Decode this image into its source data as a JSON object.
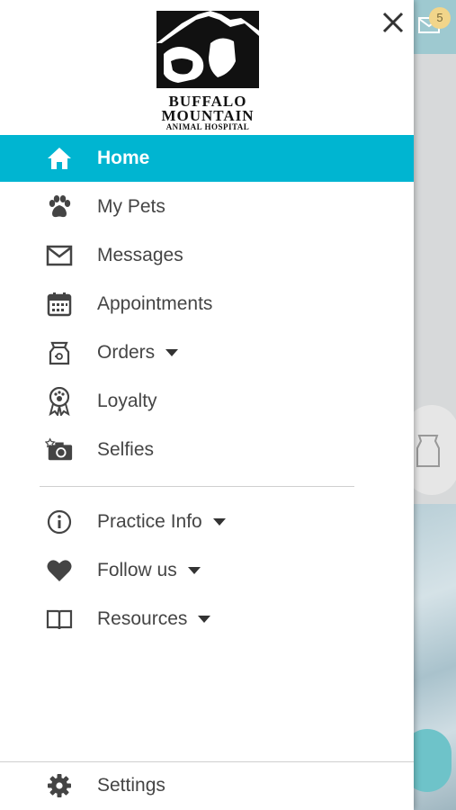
{
  "brand": {
    "line1": "BUFFALO",
    "line2": "MOUNTAIN",
    "line3": "ANIMAL HOSPITAL"
  },
  "menu": [
    {
      "label": "Home",
      "icon": "home-icon",
      "active": true
    },
    {
      "label": "My Pets",
      "icon": "paw-icon"
    },
    {
      "label": "Messages",
      "icon": "mail-icon"
    },
    {
      "label": "Appointments",
      "icon": "calendar-icon"
    },
    {
      "label": "Orders",
      "icon": "pet-food-bag-icon",
      "dropdown": true
    },
    {
      "label": "Loyalty",
      "icon": "loyalty-ribbon-icon"
    },
    {
      "label": "Selfies",
      "icon": "camera-icon"
    }
  ],
  "secondary_menu": [
    {
      "label": "Practice Info",
      "icon": "info-icon",
      "dropdown": true
    },
    {
      "label": "Follow us",
      "icon": "heart-icon",
      "dropdown": true
    },
    {
      "label": "Resources",
      "icon": "book-icon",
      "dropdown": true
    }
  ],
  "footer": {
    "label": "Settings",
    "icon": "gear-icon"
  },
  "background": {
    "mail_badge": "5"
  },
  "colors": {
    "accent": "#00b5d1",
    "icon": "#444444",
    "text": "#454545"
  }
}
